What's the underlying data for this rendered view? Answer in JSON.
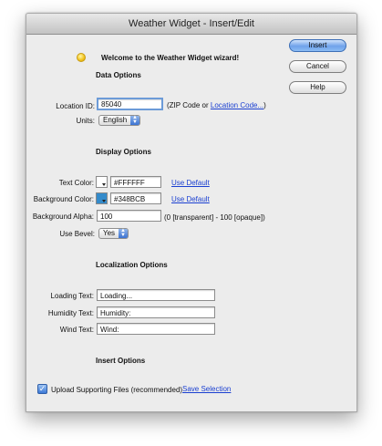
{
  "window": {
    "title": "Weather Widget - Insert/Edit"
  },
  "welcome": {
    "text": "Welcome to the Weather Widget wizard!",
    "icon": "lightbulb-icon"
  },
  "buttons": {
    "insert": "Insert",
    "cancel": "Cancel",
    "help": "Help"
  },
  "data_options": {
    "heading": "Data Options",
    "location_label": "Location ID:",
    "location_value": "85040",
    "location_hint_prefix": "(ZIP Code or ",
    "location_hint_link": "Location Code...",
    "location_hint_suffix": ")",
    "units_label": "Units:",
    "units_value": "English"
  },
  "display_options": {
    "heading": "Display Options",
    "text_color_label": "Text Color:",
    "text_color_value": "#FFFFFF",
    "text_color_swatch": "#ffffff",
    "text_color_default": "Use Default",
    "bg_color_label": "Background Color:",
    "bg_color_value": "#348BCB",
    "bg_color_swatch": "#348bcb",
    "bg_color_default": "Use Default",
    "bg_alpha_label": "Background Alpha:",
    "bg_alpha_value": "100",
    "bg_alpha_hint": "(0 [transparent] - 100 [opaque])",
    "bevel_label": "Use Bevel:",
    "bevel_value": "Yes"
  },
  "localization_options": {
    "heading": "Localization Options",
    "loading_label": "Loading Text:",
    "loading_value": "Loading...",
    "humidity_label": "Humidity Text:",
    "humidity_value": "Humidity:",
    "wind_label": "Wind Text:",
    "wind_value": "Wind:"
  },
  "insert_options": {
    "heading": "Insert Options",
    "upload_label": "Upload Supporting Files (recommended)",
    "upload_checked": true,
    "save_selection": "Save Selection"
  }
}
